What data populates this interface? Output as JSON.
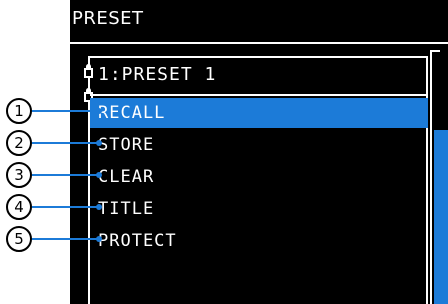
{
  "screen": {
    "title": "PRESET"
  },
  "menu": {
    "preset_name": "1:PRESET 1",
    "items": [
      {
        "label": "RECALL",
        "selected": true
      },
      {
        "label": "STORE",
        "selected": false
      },
      {
        "label": "CLEAR",
        "selected": false
      },
      {
        "label": "TITLE",
        "selected": false
      },
      {
        "label": "PROTECT",
        "selected": false
      }
    ]
  },
  "callouts": [
    "1",
    "2",
    "3",
    "4",
    "5"
  ],
  "colors": {
    "selection": "#1c7bd8",
    "lcd_background": "#000000",
    "lcd_text": "#ffffff"
  }
}
